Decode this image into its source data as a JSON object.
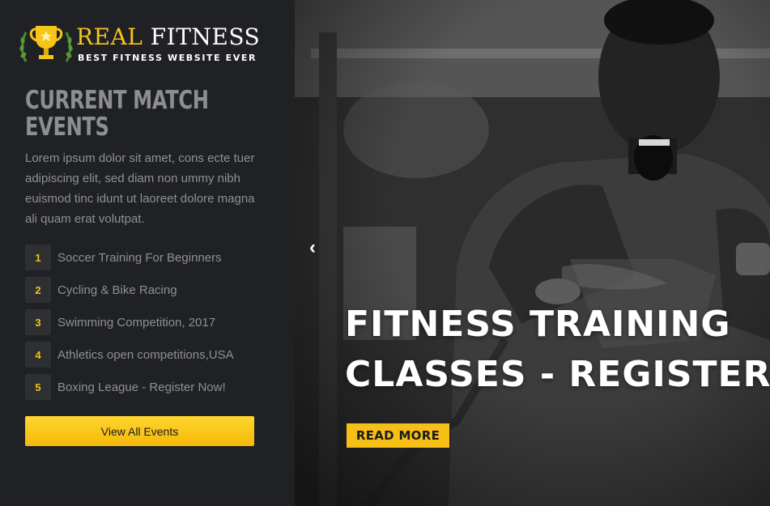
{
  "brand": {
    "name_part1": "REAL",
    "name_part2": "FITNESS",
    "tagline": "BEST FITNESS WEBSITE EVER",
    "accent_color": "#f7c419"
  },
  "events": {
    "title_line1": "CURRENT MATCH",
    "title_line2": "EVENTS",
    "description": "Lorem ipsum dolor sit amet, cons ecte tuer adipiscing elit, sed diam non ummy nibh euismod tinc idunt ut laoreet dolore magna ali quam erat volutpat.",
    "items": [
      {
        "number": "1",
        "label": "Soccer Training For Beginners"
      },
      {
        "number": "2",
        "label": "Cycling & Bike Racing"
      },
      {
        "number": "3",
        "label": "Swimming Competition, 2017"
      },
      {
        "number": "4",
        "label": "Athletics open competitions,USA"
      },
      {
        "number": "5",
        "label": "Boxing League - Register Now!"
      }
    ],
    "view_all_label": "View All Events"
  },
  "hero": {
    "prev_icon": "‹",
    "title_line1": "FITNESS TRAINING",
    "title_line2": "CLASSES - REGISTER",
    "read_more_label": "READ MORE",
    "button_color": "#f6bf16"
  }
}
